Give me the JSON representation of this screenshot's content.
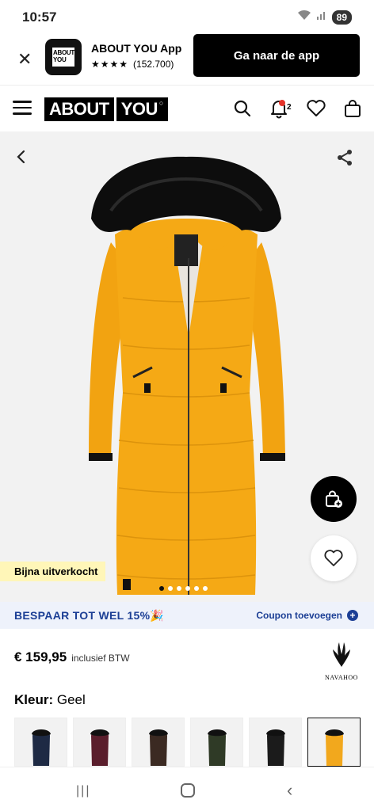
{
  "status": {
    "time": "10:57",
    "battery": "89"
  },
  "banner": {
    "logo_line1": "ABOUT",
    "logo_line2": "YOU",
    "title": "ABOUT YOU App",
    "stars": "★★★★",
    "rating_count": "(152.700)",
    "cta": "Ga naar de app"
  },
  "header": {
    "brand_part1": "ABOUT",
    "brand_part2": "YOU",
    "notification_count": "2"
  },
  "gallery": {
    "sale_badge": "Bijna uitverkocht",
    "image_count": 6,
    "active_image": 1
  },
  "promo": {
    "text": "BESPAAR TOT WEL 15%🎉",
    "coupon_label": "Coupon toevoegen"
  },
  "product": {
    "price": "€ 159,95",
    "vat_note": "inclusief BTW",
    "brand_logo_text": "NAVAHOO",
    "color_label": "Kleur:",
    "color_value": "Geel"
  },
  "swatches": [
    {
      "color": "#1e2a44",
      "selected": false
    },
    {
      "color": "#5a1e2c",
      "selected": false
    },
    {
      "color": "#3b2a22",
      "selected": false
    },
    {
      "color": "#2f3a26",
      "selected": false
    },
    {
      "color": "#1b1b1b",
      "selected": false
    },
    {
      "color": "#f2a81d",
      "selected": true
    }
  ],
  "colors": {
    "coat_yellow": "#f5a915",
    "promo_text": "#1c3f95",
    "sale_badge_bg": "#fff6b8"
  }
}
